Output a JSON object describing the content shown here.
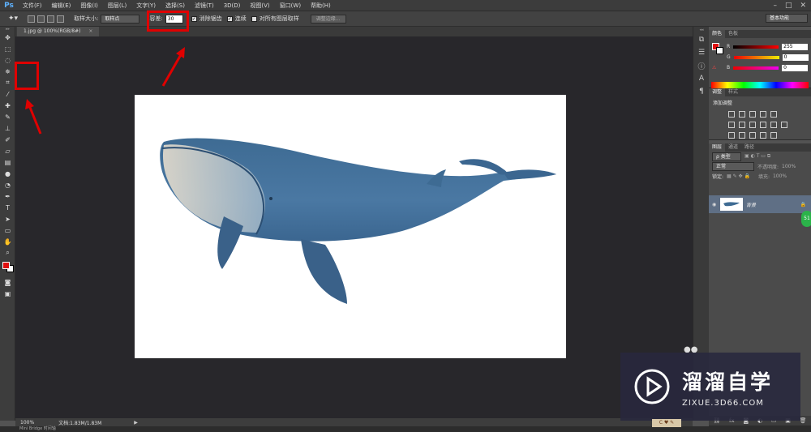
{
  "menubar": {
    "app_logo": "Ps",
    "items": [
      "文件(F)",
      "编辑(E)",
      "图像(I)",
      "图层(L)",
      "文字(Y)",
      "选择(S)",
      "滤镜(T)",
      "3D(D)",
      "视图(V)",
      "窗口(W)",
      "帮助(H)"
    ],
    "window_controls": [
      "–",
      "□",
      "✕"
    ]
  },
  "options_bar": {
    "sample_size_label": "取样大小:",
    "sample_size_value": "取样点",
    "tolerance_label": "容差:",
    "tolerance_value": "30",
    "antialias_label": "消除锯齿",
    "contiguous_label": "连续",
    "sample_all_label": "对所有图层取样",
    "refine_edge_label": "调整边缘...",
    "workspace_value": "基本功能"
  },
  "document": {
    "tab_title": "1.jpg @ 100%(RGB/8#)",
    "tab_close": "×"
  },
  "status_bar": {
    "zoom": "100%",
    "doc_size": "文档:1.83M/1.83M"
  },
  "bottom_bar": {
    "label": "Mini Bridge   时间轴"
  },
  "color_panel": {
    "tabs": [
      "颜色",
      "色板"
    ],
    "rows": [
      {
        "channel": "R",
        "value": "255",
        "color": "#ff0000"
      },
      {
        "channel": "G",
        "value": "0",
        "color": "#00ff00"
      },
      {
        "channel": "B",
        "value": "0",
        "color": "#0000ff"
      }
    ]
  },
  "adjustments_panel": {
    "tabs": [
      "调整",
      "样式"
    ],
    "title": "添加调整"
  },
  "layers_panel": {
    "tabs": [
      "图层",
      "通道",
      "路径"
    ],
    "kind_label": "ρ 类型",
    "blend_mode": "正常",
    "opacity_label": "不透明度:",
    "opacity_value": "100%",
    "lock_label": "锁定:",
    "fill_label": "填充:",
    "fill_value": "100%",
    "layer_name": "背景"
  },
  "bubble": {
    "text": "51"
  },
  "watermark": {
    "title": "溜溜自学",
    "subtitle": "ZIXUE.3D66.COM"
  },
  "sticker": {
    "text": "C ♥ ✎"
  },
  "colors": {
    "foreground": "#e01010",
    "background": "#ffffff",
    "callout": "#e00000",
    "layer_selected": "#5f6f85"
  }
}
